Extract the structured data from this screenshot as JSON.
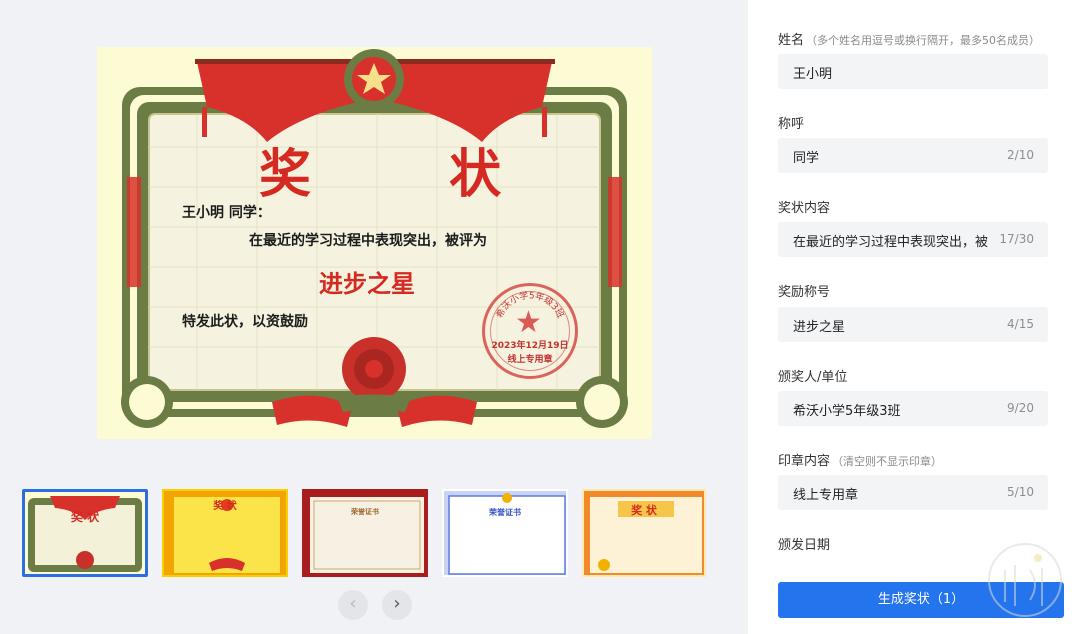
{
  "certificate": {
    "title": "奖 状",
    "recipient_line": "王小明 同学：",
    "content": "在最近的学习过程中表现突出，被评为",
    "award": "进步之星",
    "closing": "特发此状，以资鼓励",
    "stamp": {
      "issuer": "希沃小学5年级3班",
      "date": "2023年12月19日",
      "text": "线上专用章"
    }
  },
  "templates": [
    {
      "name": "template-red-classic",
      "label": "奖 状",
      "selected": true,
      "color": "#6b7c45"
    },
    {
      "name": "template-yellow",
      "label": "奖 状",
      "selected": false,
      "color": "#f2b200"
    },
    {
      "name": "template-dark-red",
      "label": "荣誉证书",
      "selected": false,
      "color": "#a81d1d"
    },
    {
      "name": "template-blue",
      "label": "荣誉证书",
      "selected": false,
      "color": "#5b7be0"
    },
    {
      "name": "template-orange",
      "label": "奖 状",
      "selected": false,
      "color": "#f08a2b"
    }
  ],
  "nav": {
    "prev_icon": "‹",
    "next_icon": "›"
  },
  "form": {
    "name": {
      "label": "姓名",
      "hint": "（多个姓名用逗号或换行隔开，最多50名成员）",
      "value": "王小明"
    },
    "title": {
      "label": "称呼",
      "value": "同学",
      "count": "2/10"
    },
    "content": {
      "label": "奖状内容",
      "value": "在最近的学习过程中表现突出，被评为",
      "count": "17/30"
    },
    "award": {
      "label": "奖励称号",
      "value": "进步之星",
      "count": "4/15"
    },
    "issuer": {
      "label": "颁奖人/单位",
      "value": "希沃小学5年级3班",
      "count": "9/20"
    },
    "stamp": {
      "label": "印章内容",
      "hint": "（清空则不显示印章）",
      "value": "线上专用章",
      "count": "5/10"
    },
    "date": {
      "label": "颁发日期"
    },
    "submit_label": "生成奖状（1）"
  },
  "colors": {
    "accent": "#2474ed",
    "certificate_red": "#d52a22",
    "frame_green": "#6b7c45"
  }
}
